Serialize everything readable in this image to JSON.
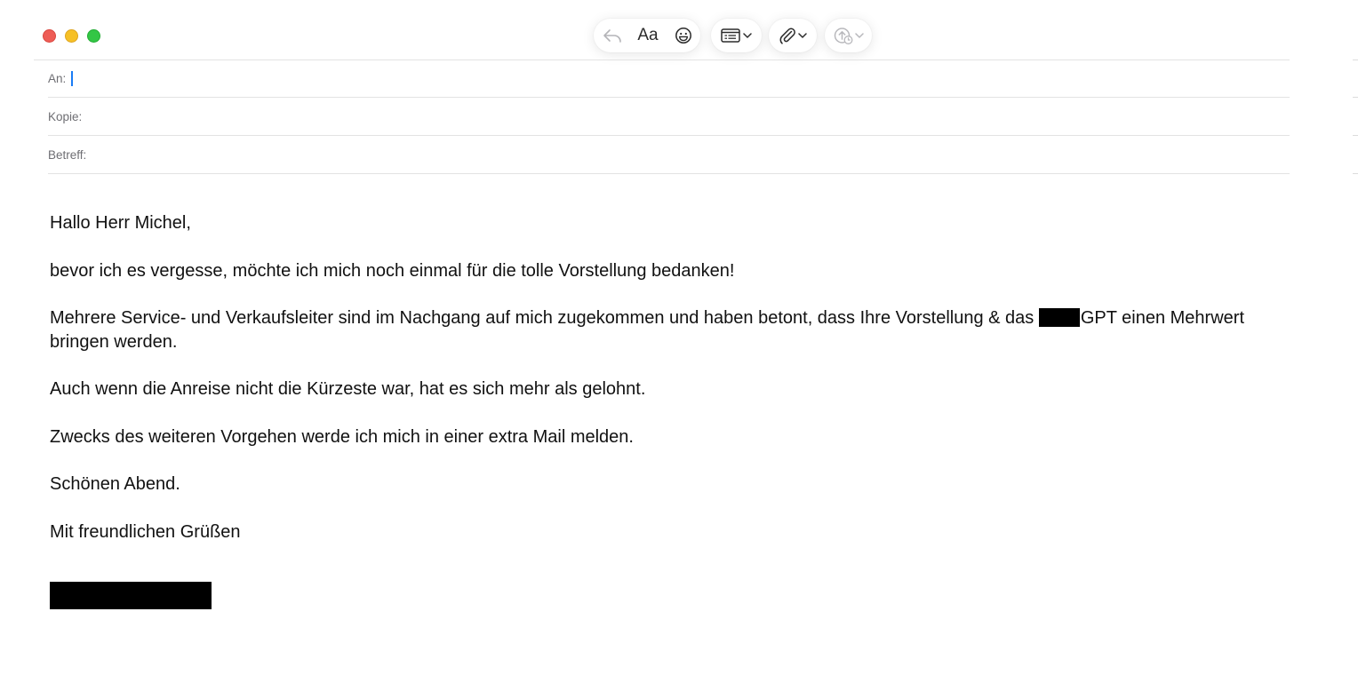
{
  "window": {
    "controls": [
      "close",
      "minimize",
      "zoom"
    ]
  },
  "toolbar": {
    "reply_icon": "reply-arrow-icon",
    "format_label": "Aa",
    "emoji_icon": "smiley-face-icon",
    "header_fields_icon": "header-list-icon",
    "attach_icon": "paperclip-icon",
    "send_later_icon": "upload-clock-icon"
  },
  "fields": {
    "to_label": "An:",
    "to_value": "",
    "cc_label": "Kopie:",
    "cc_value": "",
    "subject_label": "Betreff:",
    "subject_value": ""
  },
  "message": {
    "greeting": "Hallo Herr Michel,",
    "line1": "bevor ich es vergesse, möchte ich mich noch einmal für die tolle Vorstellung bedanken!",
    "line2_before": "Mehrere Service- und Verkaufsleiter sind im Nachgang auf mich zugekommen und haben betont, dass Ihre Vorstellung & das ",
    "line2_after": "GPT einen Mehrwert bringen werden.",
    "line3": "Auch wenn die Anreise nicht die Kürzeste war, hat es sich mehr als gelohnt.",
    "line4": "Zwecks des weiteren Vorgehen werde ich mich in einer extra Mail melden.",
    "line5": "Schönen Abend.",
    "closing": "Mit freundlichen Grüßen"
  },
  "colors": {
    "caret": "#1a7cf5",
    "close": "#ee5d56",
    "minimize": "#f6c026",
    "zoom": "#33c645",
    "redaction": "#000000"
  }
}
